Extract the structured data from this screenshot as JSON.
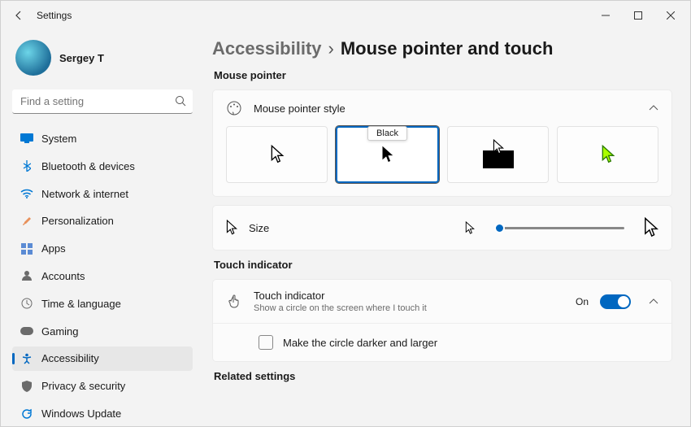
{
  "window": {
    "title": "Settings"
  },
  "user": {
    "name": "Sergey T"
  },
  "search": {
    "placeholder": "Find a setting"
  },
  "nav": {
    "items": [
      "System",
      "Bluetooth & devices",
      "Network & internet",
      "Personalization",
      "Apps",
      "Accounts",
      "Time & language",
      "Gaming",
      "Accessibility",
      "Privacy & security",
      "Windows Update"
    ],
    "active_index": 8
  },
  "breadcrumb": {
    "parent": "Accessibility",
    "page": "Mouse pointer and touch"
  },
  "sections": {
    "mouse_pointer": "Mouse pointer",
    "touch_indicator": "Touch indicator",
    "related": "Related settings"
  },
  "pointer_style": {
    "label": "Mouse pointer style",
    "selected_index": 1,
    "tooltip": "Black"
  },
  "size": {
    "label": "Size"
  },
  "touch": {
    "label": "Touch indicator",
    "sub": "Show a circle on the screen where I touch it",
    "state": "On",
    "sub_option": "Make the circle darker and larger"
  }
}
